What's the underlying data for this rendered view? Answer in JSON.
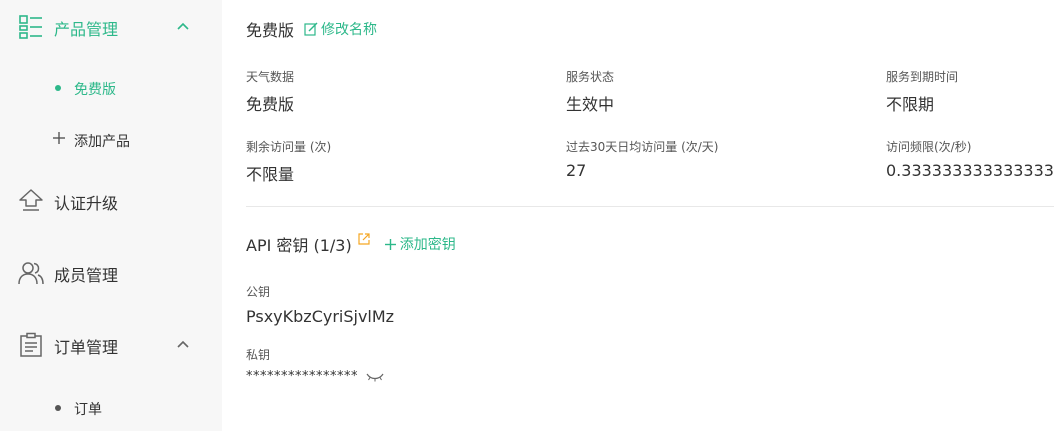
{
  "sidebar": {
    "product_mgmt": {
      "label": "产品管理",
      "icon": "product-grid-icon"
    },
    "free_plan": {
      "label": "免费版"
    },
    "add_product": {
      "label": "添加产品"
    },
    "cert_upgrade": {
      "label": "认证升级",
      "icon": "upgrade-icon"
    },
    "member_mgmt": {
      "label": "成员管理",
      "icon": "members-icon"
    },
    "order_mgmt": {
      "label": "订单管理",
      "icon": "clipboard-icon"
    },
    "orders": {
      "label": "订单"
    }
  },
  "main": {
    "title": "免费版",
    "edit_name_label": "修改名称",
    "stats": [
      {
        "key": "天气数据",
        "value": "免费版"
      },
      {
        "key": "服务状态",
        "value": "生效中"
      },
      {
        "key": "服务到期时间",
        "value": "不限期"
      },
      {
        "key": "剩余访问量 (次)",
        "value": "不限量"
      },
      {
        "key": "过去30天日均访问量 (次/天)",
        "value": "27"
      },
      {
        "key": "访问频限(次/秒)",
        "value": "0.3333333333333333"
      }
    ],
    "api_title": "API 密钥 (1/3)",
    "add_key_label": "添加密钥",
    "public_key_label": "公钥",
    "public_key_value": "PsxyKbzCyriSjvlMz",
    "private_key_label": "私钥",
    "private_key_mask": "****************"
  },
  "colors": {
    "accent": "#2db88a",
    "sidebar_bg": "#f7f7f7",
    "external_link": "#f5a623"
  }
}
